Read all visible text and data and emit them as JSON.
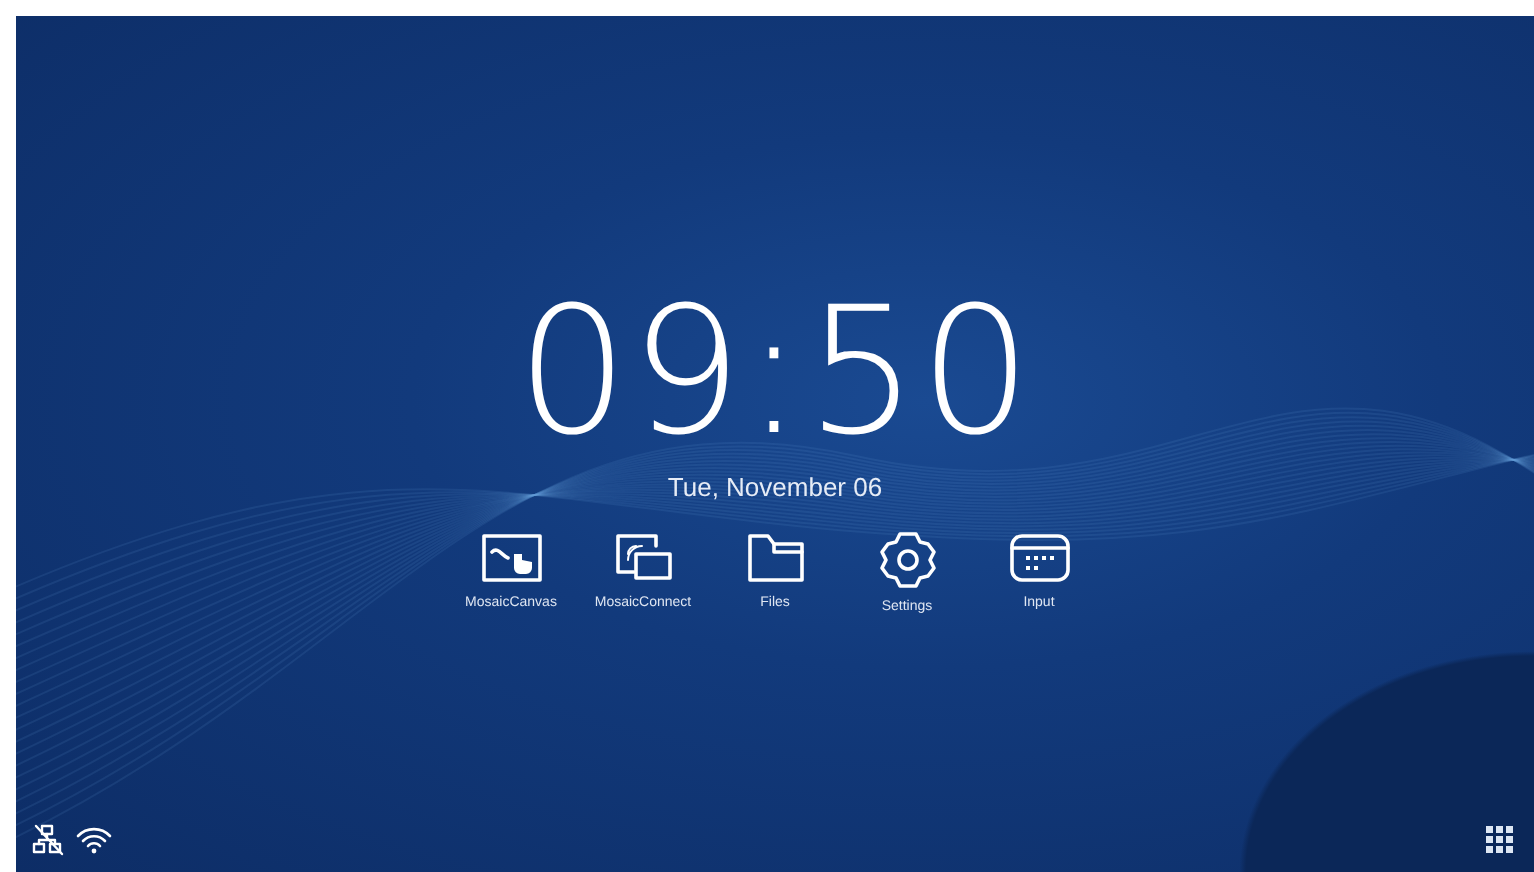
{
  "clock": {
    "time": "09:50",
    "date": "Tue, November 06"
  },
  "apps": [
    {
      "kind": "canvas",
      "label": "MosaicCanvas"
    },
    {
      "kind": "connect",
      "label": "MosaicConnect"
    },
    {
      "kind": "files",
      "label": "Files"
    },
    {
      "kind": "settings",
      "label": "Settings"
    },
    {
      "kind": "input",
      "label": "Input"
    }
  ]
}
